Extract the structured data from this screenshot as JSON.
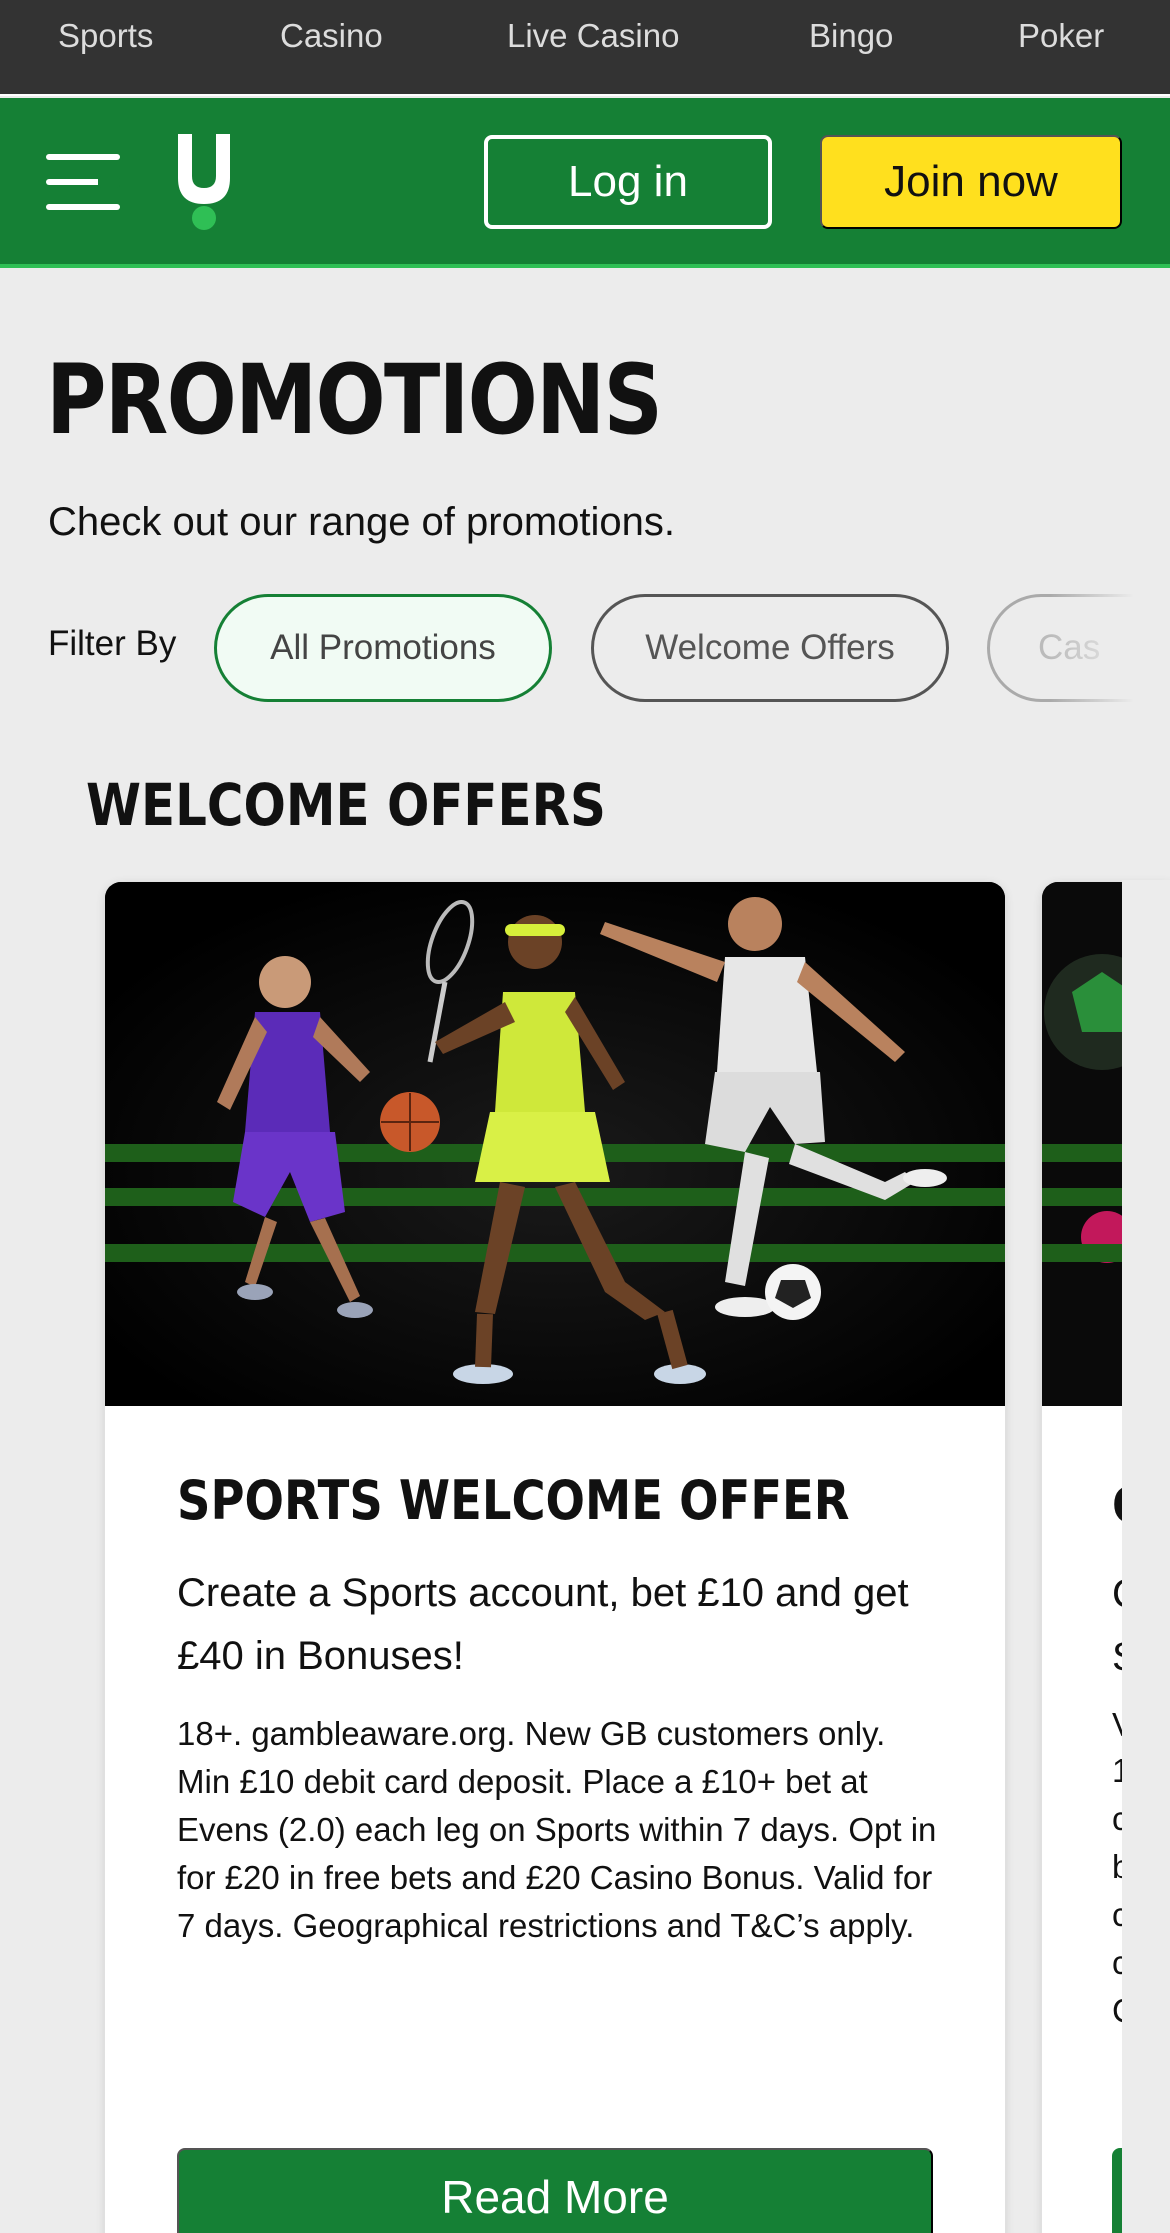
{
  "topnav": {
    "items": [
      "Sports",
      "Casino",
      "Live Casino",
      "Bingo",
      "Poker"
    ]
  },
  "header": {
    "login_label": "Log in",
    "join_label": "Join now",
    "logo_letter": "U"
  },
  "page": {
    "title": "PROMOTIONS",
    "subtitle": "Check out our range of promotions."
  },
  "filters": {
    "label": "Filter By",
    "chips": [
      "All Promotions",
      "Welcome Offers",
      "Cas"
    ],
    "active": "All Promotions"
  },
  "section": {
    "title": "WELCOME OFFERS"
  },
  "card": {
    "title": "SPORTS WELCOME OFFER",
    "headline": "Create a Sports account, bet £10 and get £40 in Bonuses!",
    "terms": "18+. gambleaware.org. New GB customers only. Min £10 debit card deposit. Place a £10+ bet at Evens (2.0) each leg on Sports within 7 days. Opt in for £20 in free bets and £20 Casino Bonus. Valid for 7 days. Geographical restrictions and T&C’s apply.",
    "button_label": "Read More"
  },
  "card_peek": {
    "chars": [
      "C",
      "C",
      "S",
      "V",
      "1",
      "c",
      "b",
      "c",
      "c",
      "C"
    ]
  },
  "colors": {
    "brand_green": "#158035",
    "accent_yellow": "#ffe01e",
    "logo_dot": "#2fbf55",
    "topnav_bg": "#333333"
  }
}
